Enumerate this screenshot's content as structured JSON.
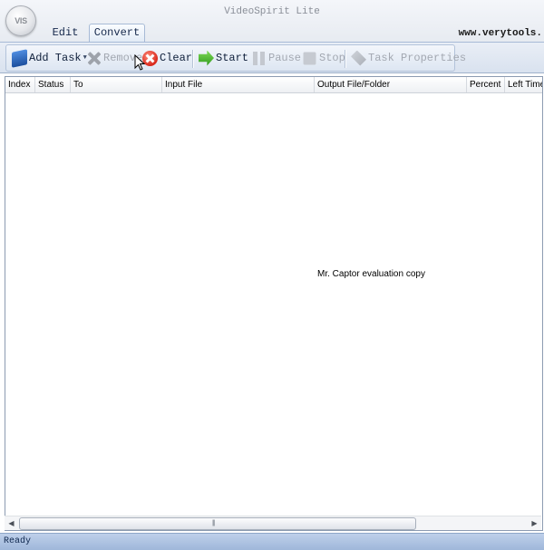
{
  "window": {
    "title": "VideoSpirit Lite",
    "website": "www.verytools.",
    "orb_label": "VIS"
  },
  "tabs": [
    {
      "label": "Edit",
      "active": false
    },
    {
      "label": "Convert",
      "active": true
    }
  ],
  "toolbar": {
    "add_task": {
      "label": "Add Task",
      "icon": "add-task-icon",
      "enabled": true,
      "has_dropdown": true
    },
    "remove": {
      "label": "Remove",
      "icon": "remove-icon",
      "enabled": false
    },
    "clear": {
      "label": "Clear",
      "icon": "clear-icon",
      "enabled": true
    },
    "start": {
      "label": "Start",
      "icon": "start-icon",
      "enabled": true
    },
    "pause": {
      "label": "Pause",
      "icon": "pause-icon",
      "enabled": false
    },
    "stop": {
      "label": "Stop",
      "icon": "stop-icon",
      "enabled": false
    },
    "task_properties": {
      "label": "Task Properties",
      "icon": "task-properties-icon",
      "enabled": false
    }
  },
  "table": {
    "columns": [
      "Index",
      "Status",
      "To",
      "Input File",
      "Output File/Folder",
      "Percent",
      "Left Time"
    ],
    "rows": []
  },
  "watermark": "Mr. Captor evaluation copy",
  "status": {
    "text": "Ready"
  },
  "colors": {
    "accent": "#a7bad6",
    "statusbar": "#aec4e2"
  }
}
